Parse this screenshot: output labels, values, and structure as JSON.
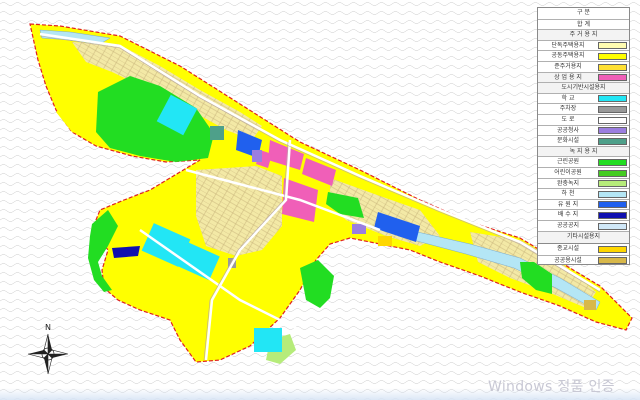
{
  "map": {
    "terrain": "contour-hatched-terrain",
    "boundary_color": "#e02020",
    "colors": {
      "residential": "#ffff00",
      "apartment": "#ffe033",
      "commercial": "#f05fb8",
      "school": "#22e6f5",
      "parking": "#999999",
      "road": "#b9aee0",
      "public_office": "#9b7ee0",
      "culture": "#4ea08a",
      "park": "#22dd22",
      "child_park": "#44cc22",
      "buffer_green": "#b6ec7a",
      "river": "#b4e6f5",
      "water_reserve": "#2060ee",
      "water_supply": "#1010b0",
      "public_empty": "#6b8fd6",
      "religion": "#ffd700",
      "public_facility": "#d8b84a"
    }
  },
  "legend": {
    "header": "구 분",
    "total": "합 계",
    "sections": [
      {
        "label": "주 거 용 지",
        "items": [
          {
            "label": "단독주택용지",
            "color": "#fffcb0"
          },
          {
            "label": "공동주택용지",
            "color": "#ffff00"
          },
          {
            "label": "준주거용지",
            "color": "#ffe033"
          }
        ]
      },
      {
        "label": "상 업 용 지",
        "swatch": "#f05fb8",
        "items": []
      },
      {
        "label": "도시기반시설용지",
        "items": [
          {
            "label": "학 교",
            "color": "#22e6f5"
          },
          {
            "label": "주차장",
            "color": "#999999"
          },
          {
            "label": "도 로",
            "color": "#ffffff"
          },
          {
            "label": "공공청사",
            "color": "#9b7ee0"
          },
          {
            "label": "문화시설",
            "color": "#4ea08a"
          }
        ]
      },
      {
        "label": "녹 지 용 지",
        "items": [
          {
            "label": "근린공원",
            "color": "#22dd22"
          },
          {
            "label": "어린이공원",
            "color": "#44cc22"
          },
          {
            "label": "완충녹지",
            "color": "#b6ec7a"
          },
          {
            "label": "하 천",
            "color": "#b4e6f5"
          },
          {
            "label": "유 원 지",
            "color": "#2060ee"
          },
          {
            "label": "배 수 지",
            "color": "#1010b0"
          },
          {
            "label": "공공공지",
            "color": "#d0e8f8"
          }
        ]
      },
      {
        "label": "기타시설용지",
        "items": [
          {
            "label": "종교시설",
            "color": "#ffd700"
          },
          {
            "label": "공공용시설",
            "color": "#d8b84a"
          }
        ]
      }
    ]
  },
  "compass": {
    "north_label": "N"
  },
  "watermark": "Windows 정품 인증"
}
